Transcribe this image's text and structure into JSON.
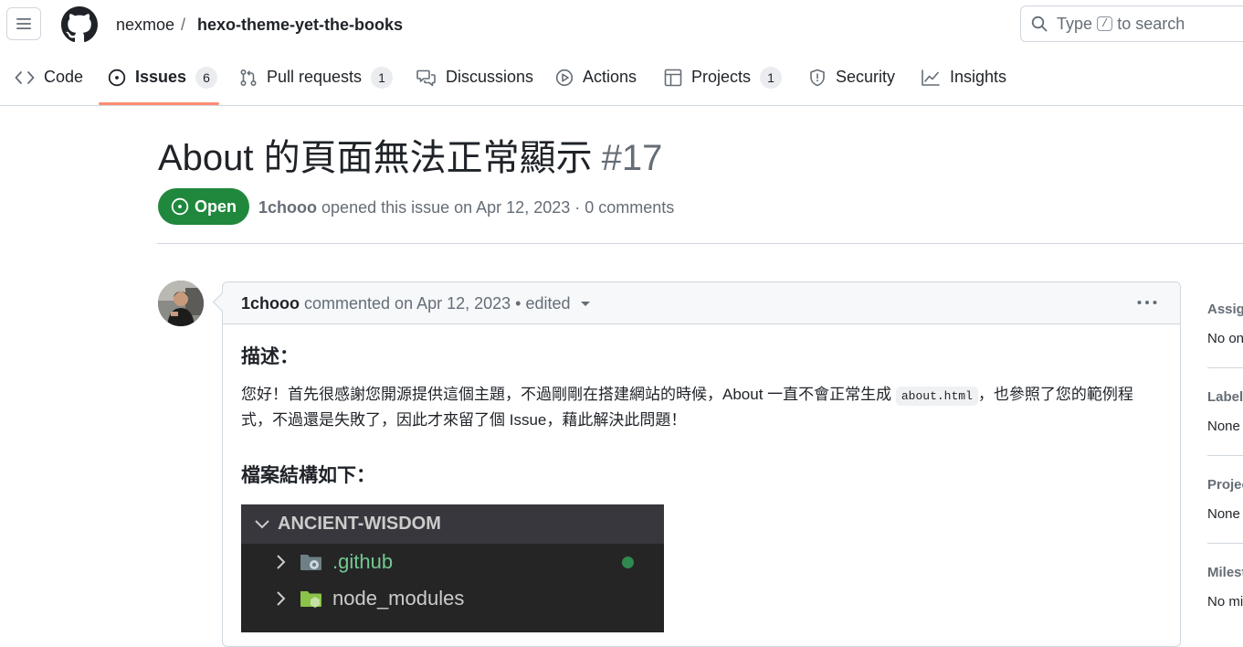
{
  "header": {
    "owner": "nexmoe",
    "separator": "/",
    "repo": "hexo-theme-yet-the-books",
    "search": {
      "prefix": "Type",
      "key": "/",
      "suffix": "to search"
    }
  },
  "repo_nav": {
    "tabs": [
      {
        "label": "Code",
        "icon": "code-icon"
      },
      {
        "label": "Issues",
        "count": "6",
        "icon": "issue-opened-icon",
        "selected": true
      },
      {
        "label": "Pull requests",
        "count": "1",
        "icon": "git-pull-request-icon"
      },
      {
        "label": "Discussions",
        "icon": "comment-discussion-icon"
      },
      {
        "label": "Actions",
        "icon": "play-icon"
      },
      {
        "label": "Projects",
        "count": "1",
        "icon": "table-icon"
      },
      {
        "label": "Security",
        "icon": "shield-icon"
      },
      {
        "label": "Insights",
        "icon": "graph-icon"
      }
    ]
  },
  "issue": {
    "title": "About 的頁面無法正常顯示",
    "number": "#17",
    "state": "Open",
    "author": "1chooo",
    "meta_text": "opened this issue on Apr 12, 2023 · 0 comments"
  },
  "comment": {
    "author": "1chooo",
    "meta_text": "commented on Apr 12, 2023 • edited",
    "body": {
      "heading1": "描述：",
      "para_before_code": "您好！首先很感謝您開源提供這個主題，不過剛剛在搭建網站的時候，About 一直不會正常生成 ",
      "code": "about.html",
      "para_after_code": "，也參照了您的範例程式，不過還是失敗了，因此才來留了個 Issue，藉此解決此問題！",
      "heading2": "檔案結構如下：",
      "explorer": {
        "root": "ANCIENT-WISDOM",
        "items": [
          {
            "name": ".github",
            "color": "#73c991"
          },
          {
            "name": "node_modules",
            "color": "#cccccc"
          }
        ]
      }
    }
  },
  "sidebar": {
    "sections": [
      {
        "title": "Assignees",
        "value": "No one assigned"
      },
      {
        "title": "Labels",
        "value": "None yet"
      },
      {
        "title": "Projects",
        "value": "None yet"
      },
      {
        "title": "Milestone",
        "value": "No milestone"
      }
    ]
  },
  "colors": {
    "open_green": "#1f883d",
    "tab_underline": "#fd8c73",
    "muted": "#656d76",
    "border": "#d0d7de"
  }
}
